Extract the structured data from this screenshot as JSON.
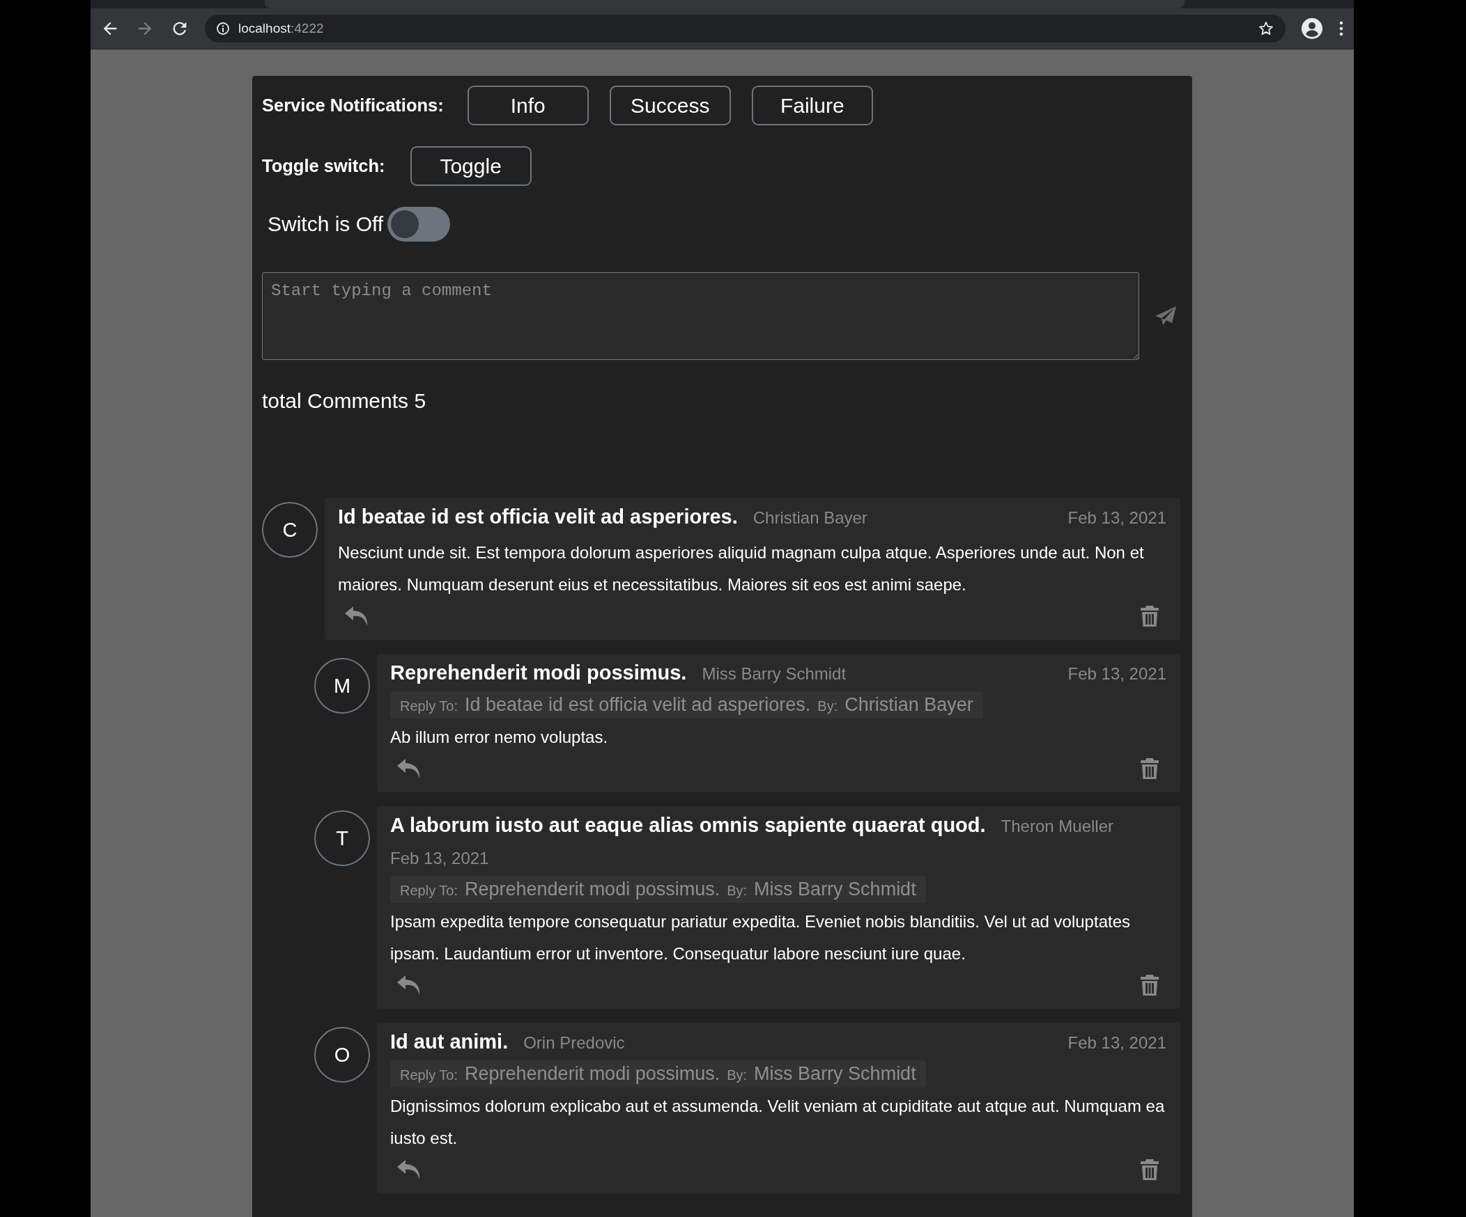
{
  "browser": {
    "url_host": "localhost",
    "url_port": ":4222",
    "forward_disabled": true
  },
  "service_notifications": {
    "label": "Service Notifications:",
    "buttons": [
      "Info",
      "Success",
      "Failure"
    ]
  },
  "toggle": {
    "label": "Toggle switch:",
    "button": "Toggle"
  },
  "switch": {
    "label": "Switch is Off",
    "on": false
  },
  "comment_box": {
    "placeholder": "Start typing a comment"
  },
  "total_comments": "total Comments 5",
  "comments": [
    {
      "avatar": "C",
      "title": "Id beatae id est officia velit ad asperiores.",
      "author": "Christian Bayer",
      "date": "Feb 13, 2021",
      "body": "Nesciunt unde sit. Est tempora dolorum asperiores aliquid magnam culpa atque. Asperiores unde aut. Non et maiores. Numquam deserunt eius et necessitatibus. Maiores sit eos est animi saepe.",
      "children": [
        {
          "avatar": "M",
          "title": "Reprehenderit modi possimus.",
          "author": "Miss Barry Schmidt",
          "date": "Feb 13, 2021",
          "reply_to": {
            "label": "Reply To:",
            "title": "Id beatae id est officia velit ad asperiores.",
            "by_label": "By:",
            "author": "Christian Bayer"
          },
          "body": "Ab illum error nemo voluptas."
        },
        {
          "avatar": "T",
          "title": "A laborum iusto aut eaque alias omnis sapiente quaerat quod.",
          "author": "Theron Mueller",
          "date": "Feb 13, 2021",
          "reply_to": {
            "label": "Reply To:",
            "title": "Reprehenderit modi possimus.",
            "by_label": "By:",
            "author": "Miss Barry Schmidt"
          },
          "body": "Ipsam expedita tempore consequatur pariatur expedita. Eveniet nobis blanditiis. Vel ut ad voluptates ipsam. Laudantium error ut inventore. Consequatur labore nesciunt iure quae."
        },
        {
          "avatar": "O",
          "title": "Id aut animi.",
          "author": "Orin Predovic",
          "date": "Feb 13, 2021",
          "reply_to": {
            "label": "Reply To:",
            "title": "Reprehenderit modi possimus.",
            "by_label": "By:",
            "author": "Miss Barry Schmidt"
          },
          "body": "Dignissimos dolorum explicabo aut et assumenda. Velit veniam at cupiditate aut atque aut. Numquam ea iusto est."
        }
      ]
    }
  ]
}
